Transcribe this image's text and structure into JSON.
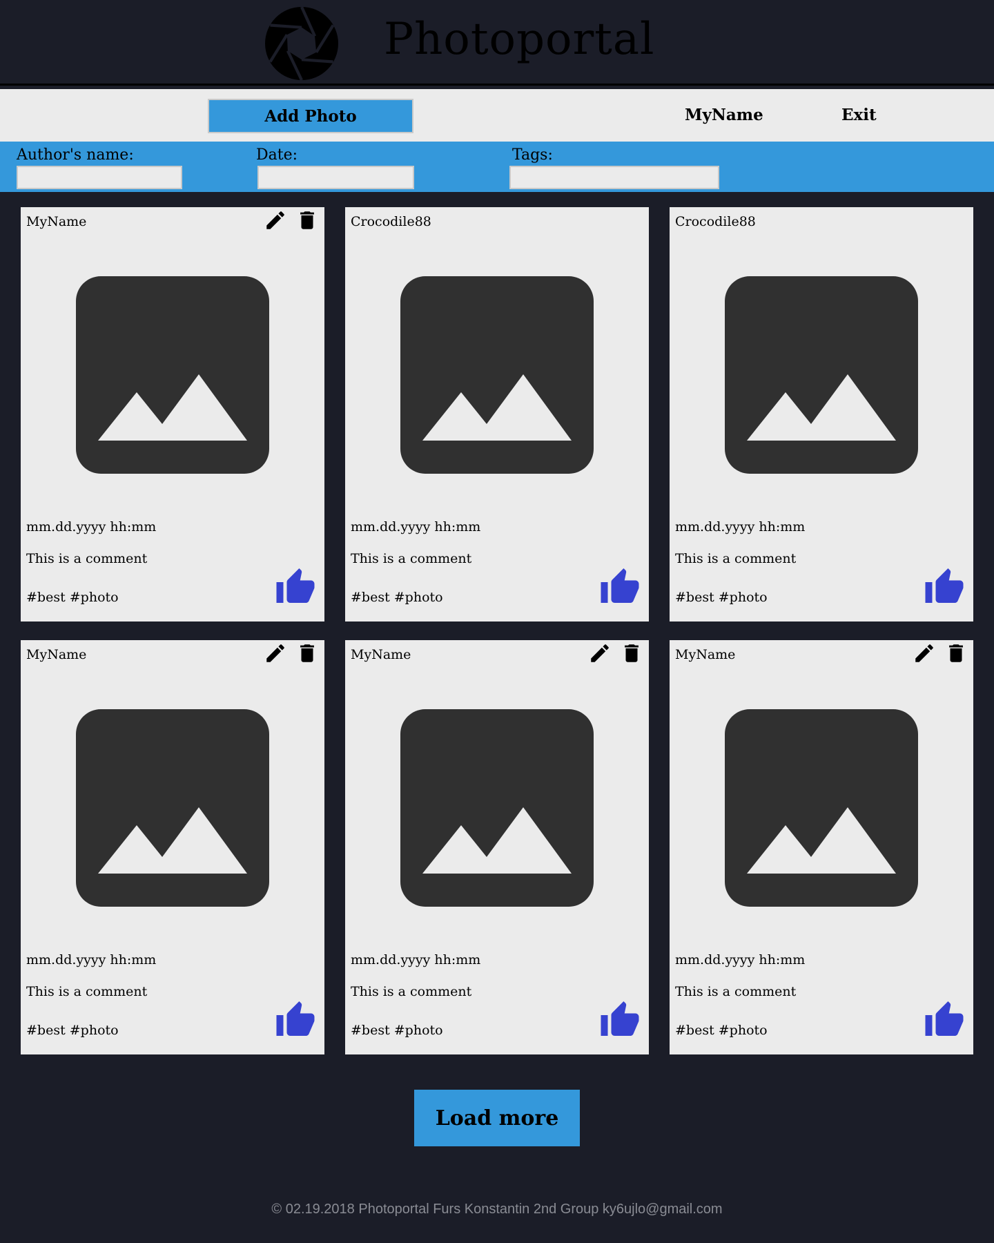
{
  "header": {
    "title": "Photoportal",
    "logo_icon": "camera-aperture-icon"
  },
  "nav": {
    "add_photo_label": "Add Photo",
    "user_label": "MyName",
    "exit_label": "Exit"
  },
  "filters": {
    "author_label": "Author's name:",
    "date_label": "Date:",
    "tags_label": "Tags:",
    "author_value": "",
    "date_value": "",
    "tags_value": ""
  },
  "posts": [
    {
      "author": "MyName",
      "date": "mm.dd.yyyy hh:mm",
      "comment": "This is a comment",
      "tags": "#best #photo",
      "editable": true
    },
    {
      "author": "Crocodile88",
      "date": "mm.dd.yyyy hh:mm",
      "comment": "This is a comment",
      "tags": "#best #photo",
      "editable": false
    },
    {
      "author": "Crocodile88",
      "date": "mm.dd.yyyy hh:mm",
      "comment": "This is a comment",
      "tags": "#best #photo",
      "editable": false
    },
    {
      "author": "MyName",
      "date": "mm.dd.yyyy hh:mm",
      "comment": "This is a comment",
      "tags": "#best #photo",
      "editable": true
    },
    {
      "author": "MyName",
      "date": "mm.dd.yyyy hh:mm",
      "comment": "This is a comment",
      "tags": "#best #photo",
      "editable": true
    },
    {
      "author": "MyName",
      "date": "mm.dd.yyyy hh:mm",
      "comment": "This is a comment",
      "tags": "#best #photo",
      "editable": true
    }
  ],
  "load_more_label": "Load more",
  "footer": {
    "text": "© 02.19.2018 Photoportal Furs Konstantin 2nd Group ky6ujlo@gmail.com"
  },
  "colors": {
    "background": "#1b1d28",
    "accent": "#3498db",
    "card": "#ebebeb",
    "like": "#3642d0",
    "image_placeholder": "#303030"
  }
}
